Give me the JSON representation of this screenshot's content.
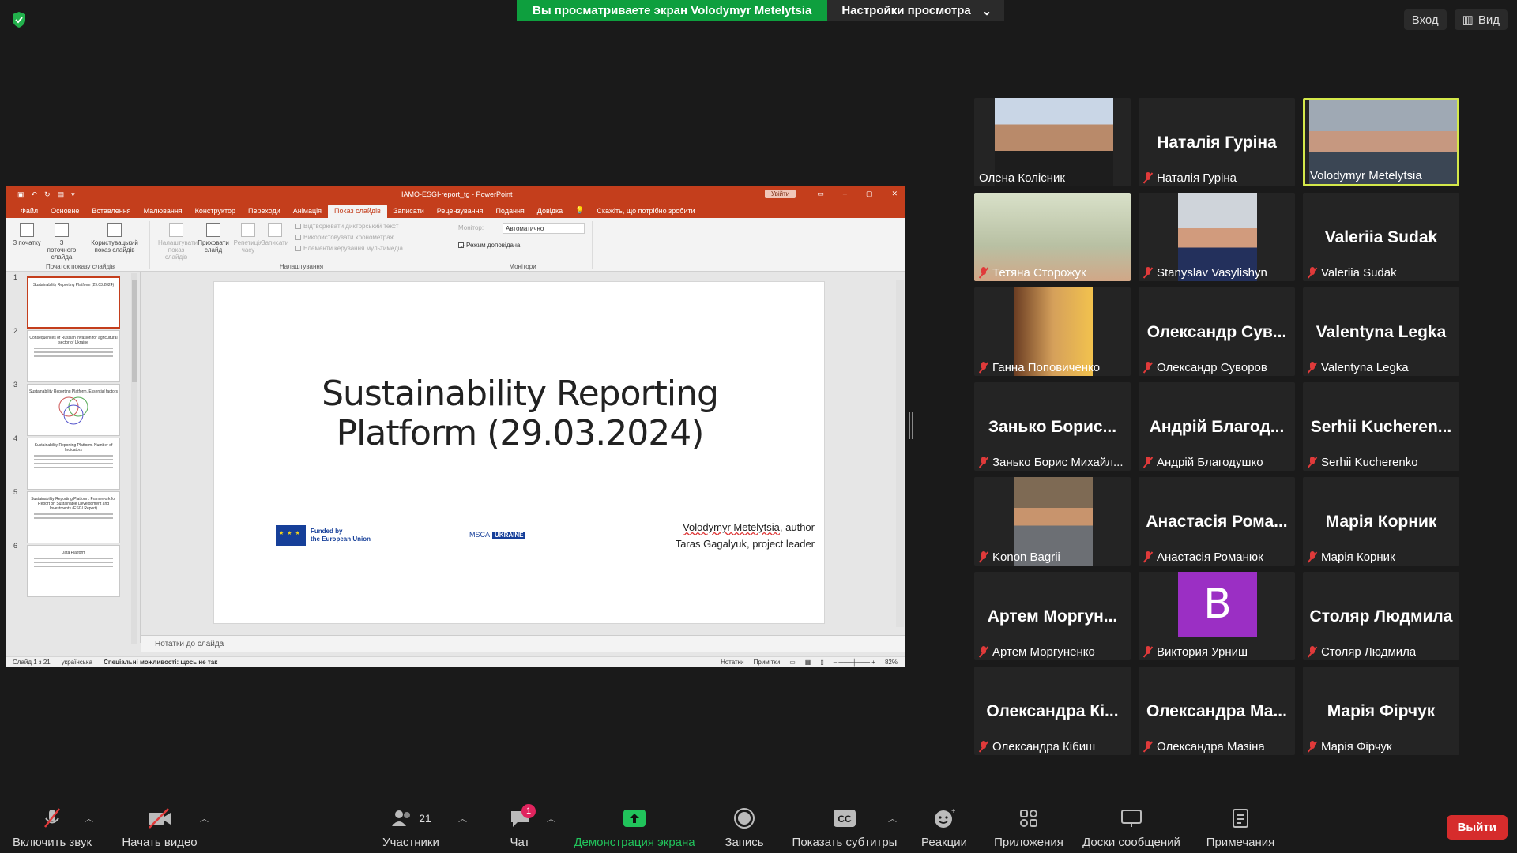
{
  "top": {
    "banner": "Вы просматриваете экран Volodymyr Metelytsia",
    "view_settings": "Настройки просмотра",
    "signin": "Вход",
    "view": "Вид"
  },
  "ppt": {
    "doc_title": "IAMO-ESGI-report_tg  -  PowerPoint",
    "signin": "Увійти",
    "tabs": [
      "Файл",
      "Основне",
      "Вставлення",
      "Малювання",
      "Конструктор",
      "Переходи",
      "Анімація",
      "Показ слайдів",
      "Записати",
      "Рецензування",
      "Подання",
      "Довідка"
    ],
    "tell_me": "Скажіть, що потрібно зробити",
    "ribbon": {
      "from_start": "З початку",
      "from_current": "З поточного слайда",
      "custom_show": "Користувацький показ слайдів",
      "group_start": "Початок показу слайдів",
      "setup": "Налаштувати показ слайдів",
      "hide": "Приховати слайд",
      "rehearse": "Репетиція часу",
      "record": "Записати",
      "chk_narration": "Відтворювати дикторський текст",
      "chk_timings": "Використовувати хронометраж",
      "chk_media": "Елементи керування мультимедіа",
      "group_setup": "Налаштування",
      "monitor": "Монітор:",
      "monitor_value": "Автоматично",
      "presenter_view": "Режим доповідача",
      "group_monitors": "Монітори"
    },
    "thumbs": [
      {
        "num": "1",
        "title": "Sustainability Reporting Platform (29.03.2024)"
      },
      {
        "num": "2",
        "title": "Consequences of Russian invasion for agricultural sector of Ukraine"
      },
      {
        "num": "3",
        "title": "Sustainability Reporting Platform. Essential factors"
      },
      {
        "num": "4",
        "title": "Sustainability Reporting Platform. Number of Indicators"
      },
      {
        "num": "5",
        "title": "Sustainability Reporting Platform. Framework for Report on Sustainable Development and Investments (ESGI Report)"
      },
      {
        "num": "6",
        "title": "Data Platform"
      }
    ],
    "slide": {
      "title_line1": "Sustainability Reporting",
      "title_line2": "Platform (29.03.2024)",
      "eu_line1": "Funded by",
      "eu_line2": "the European Union",
      "msca": "MSCA",
      "ukraine": "UKRAINE",
      "author_name": "Volodymyr Metelytsia",
      "author_role": ", author",
      "leader": "Taras Gagalyuk, project leader"
    },
    "notes": "Нотатки до слайда",
    "status": {
      "slide": "Слайд 1 з 21",
      "lang": "українська",
      "access": "Спеціальні можливості: щось не так",
      "notes": "Нотатки",
      "comments": "Примітки",
      "zoom": "82%"
    }
  },
  "gallery": [
    {
      "big": "",
      "cap": "Олена Колісник",
      "muted": false,
      "photo": "p1"
    },
    {
      "big": "Наталія Гуріна",
      "cap": "Наталія Гуріна",
      "muted": true,
      "photo": ""
    },
    {
      "big": "",
      "cap": "Volodymyr Metelytsia",
      "muted": false,
      "photo": "p6",
      "active": true
    },
    {
      "big": "",
      "cap": "Тетяна Сторожук",
      "muted": true,
      "photo": "p2"
    },
    {
      "big": "",
      "cap": "Stanyslav Vasylishyn",
      "muted": true,
      "photo": "p3"
    },
    {
      "big": "Valeriia Sudak",
      "cap": "Valeriia Sudak",
      "muted": true,
      "photo": ""
    },
    {
      "big": "",
      "cap": "Ганна Поповиченко",
      "muted": true,
      "photo": "p4"
    },
    {
      "big": "Олександр Сув...",
      "cap": "Олександр Суворов",
      "muted": true,
      "photo": ""
    },
    {
      "big": "Valentyna Legka",
      "cap": "Valentyna Legka",
      "muted": true,
      "photo": ""
    },
    {
      "big": "Занько Борис...",
      "cap": "Занько Борис Михайл...",
      "muted": true,
      "photo": ""
    },
    {
      "big": "Андрій Благод...",
      "cap": "Андрій Благодушко",
      "muted": true,
      "photo": ""
    },
    {
      "big": "Serhii Kucheren...",
      "cap": "Serhii Kucherenko",
      "muted": true,
      "photo": ""
    },
    {
      "big": "",
      "cap": "Konon Bagrii",
      "muted": true,
      "photo": "p5"
    },
    {
      "big": "Анастасія Рома...",
      "cap": "Анастасія Романюк",
      "muted": true,
      "photo": ""
    },
    {
      "big": "Марія Корник",
      "cap": "Марія Корник",
      "muted": true,
      "photo": ""
    },
    {
      "big": "Артем Моргун...",
      "cap": "Артем Моргуненко",
      "muted": true,
      "photo": ""
    },
    {
      "big": "B",
      "cap": "Виктория Урниш",
      "muted": true,
      "photo": "avatar"
    },
    {
      "big": "Столяр Людмила",
      "cap": "Столяр Людмила",
      "muted": true,
      "photo": ""
    },
    {
      "big": "Олександра Кі...",
      "cap": "Олександра Кібиш",
      "muted": true,
      "photo": ""
    },
    {
      "big": "Олександра Ма...",
      "cap": "Олександра Мазіна",
      "muted": true,
      "photo": ""
    },
    {
      "big": "Марія Фірчук",
      "cap": "Марія Фірчук",
      "muted": true,
      "photo": ""
    }
  ],
  "toolbar": {
    "unmute": "Включить звук",
    "start_video": "Начать видео",
    "participants": "Участники",
    "participants_count": "21",
    "chat": "Чат",
    "chat_badge": "1",
    "share": "Демонстрация экрана",
    "record": "Запись",
    "captions": "Показать субтитры",
    "reactions": "Реакции",
    "apps": "Приложения",
    "whiteboards": "Доски сообщений",
    "notes": "Примечания",
    "leave": "Выйти"
  },
  "colors": {
    "ppt_accent": "#c43e1c",
    "share_green": "#0e9f3e",
    "active_speaker": "#d4e84a",
    "leave_red": "#d62c2c",
    "mute_red": "#e03a3a"
  }
}
